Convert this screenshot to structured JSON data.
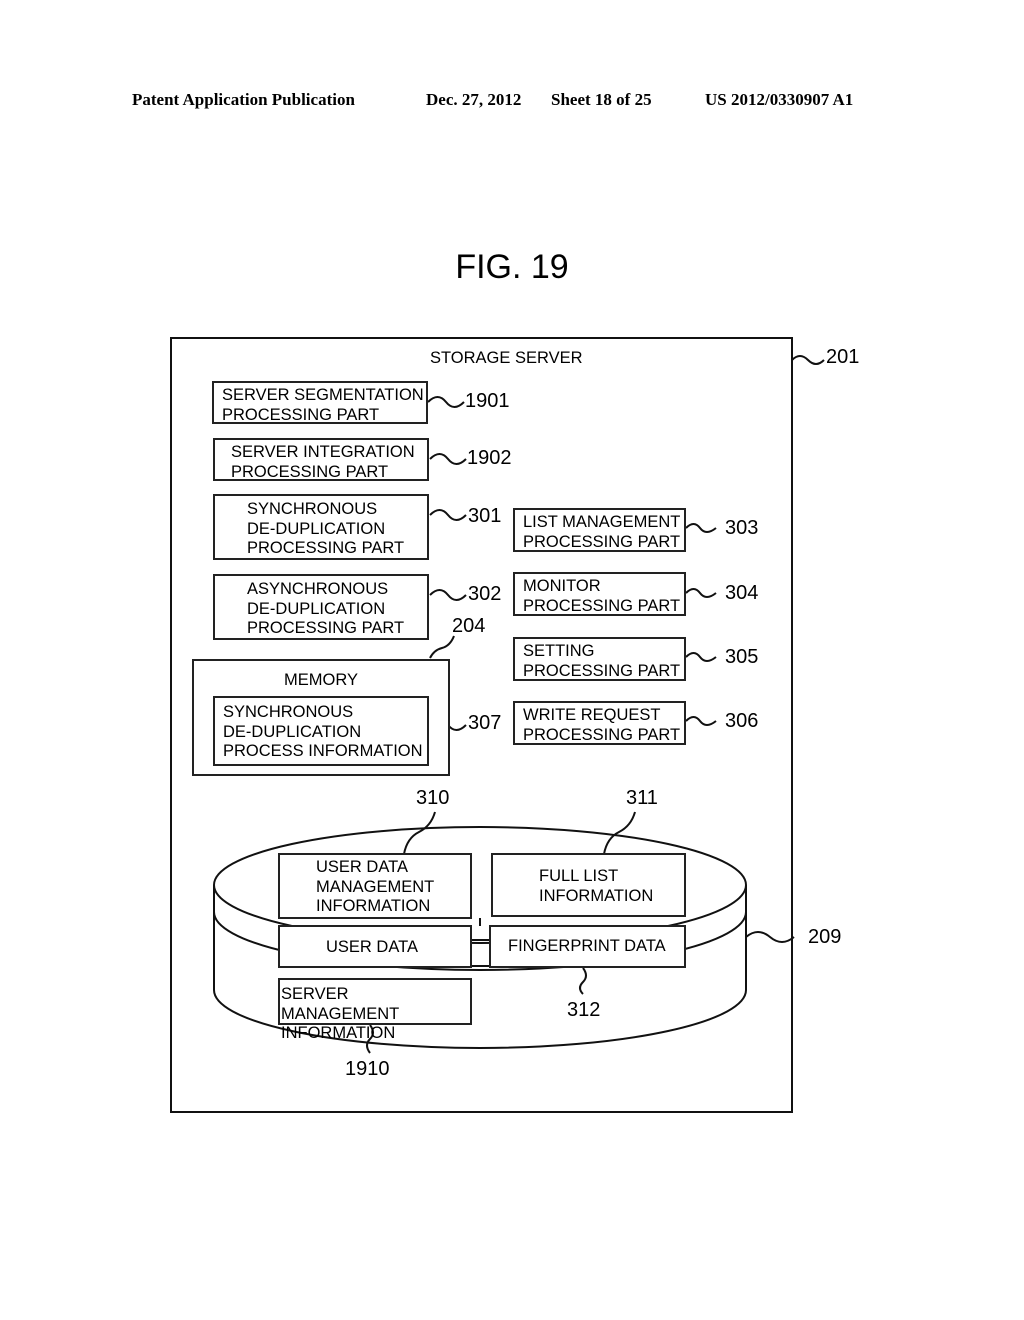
{
  "header": {
    "publication": "Patent Application Publication",
    "date": "Dec. 27, 2012",
    "sheet": "Sheet 18 of 25",
    "number": "US 2012/0330907 A1"
  },
  "figure_title": "FIG. 19",
  "storage_server": {
    "title": "STORAGE SERVER",
    "ref": "201",
    "left_parts": [
      {
        "label": "SERVER SEGMENTATION\nPROCESSING PART",
        "ref": "1901"
      },
      {
        "label": "SERVER INTEGRATION\nPROCESSING PART",
        "ref": "1902"
      },
      {
        "label": "SYNCHRONOUS\nDE-DUPLICATION\nPROCESSING PART",
        "ref": "301"
      },
      {
        "label": "ASYNCHRONOUS\nDE-DUPLICATION\nPROCESSING PART",
        "ref": "302"
      }
    ],
    "right_parts": [
      {
        "label": "LIST MANAGEMENT\nPROCESSING PART",
        "ref": "303"
      },
      {
        "label": "MONITOR\nPROCESSING PART",
        "ref": "304"
      },
      {
        "label": "SETTING\nPROCESSING PART",
        "ref": "305"
      },
      {
        "label": "WRITE REQUEST\nPROCESSING PART",
        "ref": "306"
      }
    ],
    "memory": {
      "title": "MEMORY",
      "ref": "204",
      "item": {
        "label": "SYNCHRONOUS\nDE-DUPLICATION\nPROCESS INFORMATION",
        "ref": "307"
      }
    },
    "storage": {
      "ref": "209",
      "items": [
        {
          "label": "USER DATA\nMANAGEMENT\nINFORMATION",
          "ref": "310"
        },
        {
          "label": "FULL LIST\nINFORMATION",
          "ref": "311"
        },
        {
          "label": "USER DATA",
          "ref": ""
        },
        {
          "label": "FINGERPRINT DATA",
          "ref": "312"
        },
        {
          "label": "SERVER MANAGEMENT\nINFORMATION",
          "ref": "1910"
        }
      ]
    }
  }
}
